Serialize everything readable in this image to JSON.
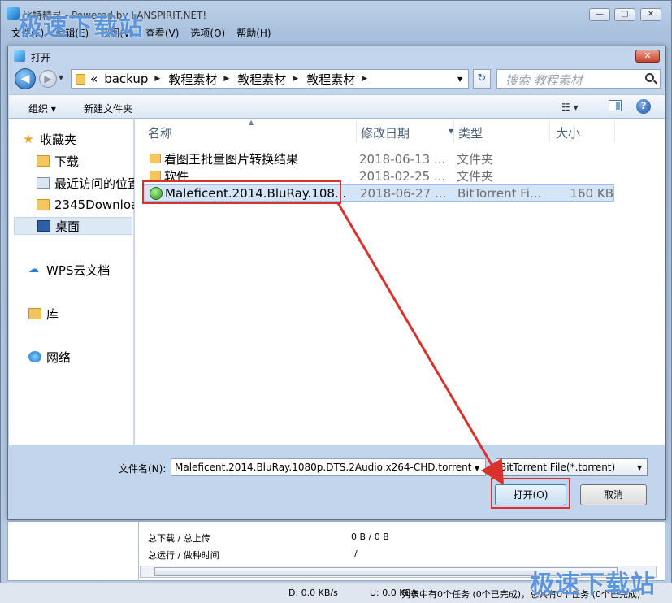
{
  "app": {
    "title": "比特精灵 - Powered by LANSPIRIT.NET!",
    "menu": [
      "文件(F)",
      "编辑(E)",
      "视图(V)",
      "查看(V)",
      "选项(O)",
      "帮助(H)"
    ],
    "win_min": "—",
    "win_max": "▢",
    "win_close": "✕"
  },
  "dialog": {
    "title": "打开",
    "close": "✕",
    "nav_back": "◀",
    "nav_fwd": "▶",
    "breadcrumbs": [
      "backup",
      "教程素材",
      "教程素材",
      "教程素材"
    ],
    "breadcrumb_prefix": "«",
    "refresh": "↻",
    "search_placeholder": "搜索 教程素材",
    "toolbar": {
      "organize": "组织 ▾",
      "new_folder": "新建文件夹",
      "views": "☷ ▾",
      "help": "?"
    },
    "nav": {
      "favorites": "收藏夹",
      "downloads": "下载",
      "recent": "最近访问的位置",
      "folder_2345": "2345Downloads",
      "desktop": "桌面",
      "wps": "WPS云文档",
      "libraries": "库",
      "network": "网络"
    },
    "columns": {
      "name": "名称",
      "date": "修改日期",
      "type": "类型",
      "size": "大小"
    },
    "files": [
      {
        "name": "看图王批量图片转换结果",
        "date": "2018-06-13 ...",
        "type": "文件夹",
        "size": ""
      },
      {
        "name": "软件",
        "date": "2018-02-25 ...",
        "type": "文件夹",
        "size": ""
      },
      {
        "name": "Maleficent.2014.BluRay.108...",
        "date": "2018-06-27 ...",
        "type": "BitTorrent Fi...",
        "size": "160 KB"
      }
    ],
    "filename_label": "文件名(N):",
    "filename_value": "Maleficent.2014.BluRay.1080p.DTS.2Audio.x264-CHD.torrent",
    "filetype": "BitTorrent File(*.torrent)",
    "open_button": "打开(O)",
    "cancel_button": "取消"
  },
  "status_panel": {
    "dl_ul_label": "总下载 / 总上传",
    "dl_ul_value": "0 B / 0 B",
    "run_seed_label": "总运行 / 做种时间",
    "run_seed_value": "/"
  },
  "statusbar": {
    "down": "D: 0.0 KB/s",
    "up": "U: 0.0 KB/s",
    "tasks": "列表中有0个任务 (0个已完成)，总共有0个任务 (0个已完成)"
  },
  "watermark": "极速下载站",
  "colors": {
    "highlight": "#d9312b",
    "watermark": "#3078d2",
    "selection": "#d5e5f8"
  }
}
